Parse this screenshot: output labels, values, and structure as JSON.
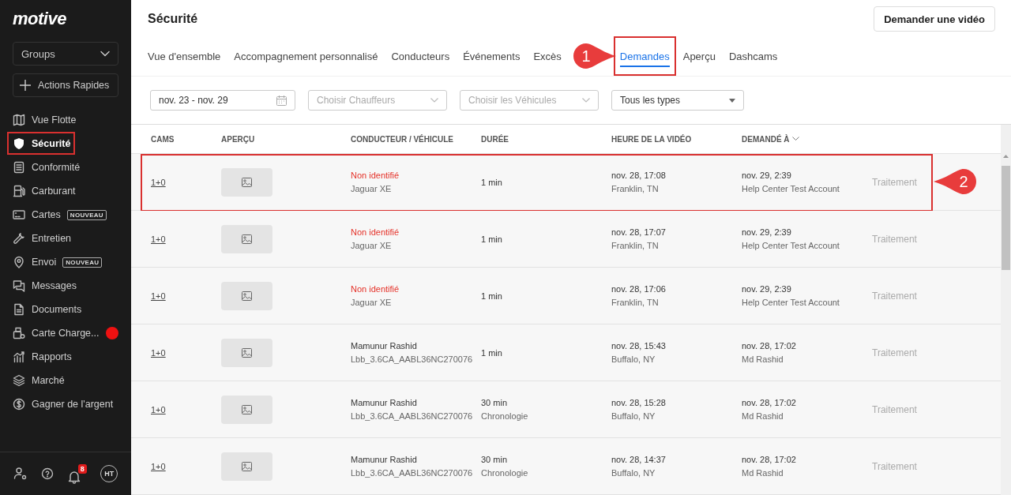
{
  "sidebar": {
    "logo": "motive",
    "groups_select": {
      "value": "Groups"
    },
    "quick_actions": "Actions Rapides",
    "items": [
      {
        "label": "Vue Flotte",
        "selected": false,
        "highlighted": false
      },
      {
        "label": "Sécurité",
        "selected": true,
        "highlighted": true
      },
      {
        "label": "Conformité",
        "selected": false,
        "highlighted": false
      },
      {
        "label": "Carburant",
        "selected": false,
        "highlighted": false
      },
      {
        "label": "Cartes",
        "badge": "NOUVEAU",
        "selected": false,
        "highlighted": false
      },
      {
        "label": "Entretien",
        "selected": false,
        "highlighted": false
      },
      {
        "label": "Envoi",
        "badge": "NOUVEAU",
        "selected": false,
        "highlighted": false
      },
      {
        "label": "Messages",
        "selected": false,
        "highlighted": false
      },
      {
        "label": "Documents",
        "selected": false,
        "highlighted": false
      },
      {
        "label": "Carte Charge...",
        "alert": true,
        "selected": false,
        "highlighted": false
      },
      {
        "label": "Rapports",
        "selected": false,
        "highlighted": false
      },
      {
        "label": "Marché",
        "selected": false,
        "highlighted": false
      },
      {
        "label": "Gagner de l'argent",
        "selected": false,
        "highlighted": false
      }
    ],
    "footer": {
      "notifications_count": "8",
      "avatar": "HT"
    }
  },
  "page": {
    "title": "Sécurité",
    "request_button": "Demander une vidéo"
  },
  "tabs": [
    {
      "label": "Vue d'ensemble",
      "selected": false,
      "highlighted": false
    },
    {
      "label": "Accompagnement personnalisé",
      "selected": false,
      "highlighted": false
    },
    {
      "label": "Conducteurs",
      "selected": false,
      "highlighted": false
    },
    {
      "label": "Événements",
      "selected": false,
      "highlighted": false
    },
    {
      "label": "Excès",
      "selected": false,
      "highlighted": false
    },
    {
      "label": "Demandes",
      "selected": true,
      "highlighted": true,
      "callout": "1"
    },
    {
      "label": "Aperçu",
      "selected": false,
      "highlighted": false
    },
    {
      "label": "Dashcams",
      "selected": false,
      "highlighted": false
    }
  ],
  "filters": {
    "date_range": {
      "value": "nov. 23 - nov. 29"
    },
    "driver": {
      "placeholder": "Choisir Chauffeurs"
    },
    "vehicle": {
      "placeholder": "Choisir les Véhicules"
    },
    "type": {
      "value": "Tous les types"
    }
  },
  "table": {
    "columns": [
      {
        "label": "CAMS",
        "sorted": false
      },
      {
        "label": "APERÇU",
        "sorted": false
      },
      {
        "label": "CONDUCTEUR / VÉHICULE",
        "sorted": false
      },
      {
        "label": "DURÉE",
        "sorted": false
      },
      {
        "label": "HEURE DE LA VIDÉO",
        "sorted": false
      },
      {
        "label": "DEMANDÉ À",
        "sorted": true
      }
    ],
    "rows": [
      {
        "cams": "1+0",
        "driver": "Non identifié",
        "unidentified": true,
        "vehicle": "Jaguar XE",
        "duration": "1 min",
        "video_time": "nov. 28, 17:08",
        "location": "Franklin, TN",
        "requested_at": "nov. 29, 2:39",
        "requested_by": "Help Center Test Account",
        "status": "Traitement",
        "highlighted": true,
        "callout": "2"
      },
      {
        "cams": "1+0",
        "driver": "Non identifié",
        "unidentified": true,
        "vehicle": "Jaguar XE",
        "duration": "1 min",
        "video_time": "nov. 28, 17:07",
        "location": "Franklin, TN",
        "requested_at": "nov. 29, 2:39",
        "requested_by": "Help Center Test Account",
        "status": "Traitement",
        "highlighted": false
      },
      {
        "cams": "1+0",
        "driver": "Non identifié",
        "unidentified": true,
        "vehicle": "Jaguar XE",
        "duration": "1 min",
        "video_time": "nov. 28, 17:06",
        "location": "Franklin, TN",
        "requested_at": "nov. 29, 2:39",
        "requested_by": "Help Center Test Account",
        "status": "Traitement",
        "highlighted": false
      },
      {
        "cams": "1+0",
        "driver": "Mamunur Rashid",
        "unidentified": false,
        "vehicle": "Lbb_3.6CA_AABL36NC270076",
        "duration": "1 min",
        "video_time": "nov. 28, 15:43",
        "location": "Buffalo, NY",
        "requested_at": "nov. 28, 17:02",
        "requested_by": "Md Rashid",
        "status": "Traitement",
        "highlighted": false
      },
      {
        "cams": "1+0",
        "driver": "Mamunur Rashid",
        "unidentified": false,
        "vehicle": "Lbb_3.6CA_AABL36NC270076",
        "duration": "30 min",
        "duration_note": "Chronologie",
        "video_time": "nov. 28, 15:28",
        "location": "Buffalo, NY",
        "requested_at": "nov. 28, 17:02",
        "requested_by": "Md Rashid",
        "status": "Traitement",
        "highlighted": false
      },
      {
        "cams": "1+0",
        "driver": "Mamunur Rashid",
        "unidentified": false,
        "vehicle": "Lbb_3.6CA_AABL36NC270076",
        "duration": "30 min",
        "duration_note": "Chronologie",
        "video_time": "nov. 28, 14:37",
        "location": "Buffalo, NY",
        "requested_at": "nov. 28, 17:02",
        "requested_by": "Md Rashid",
        "status": "Traitement",
        "highlighted": false
      }
    ]
  }
}
